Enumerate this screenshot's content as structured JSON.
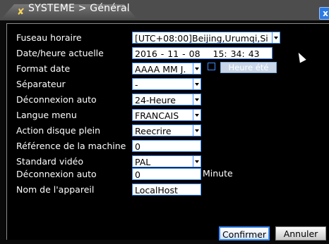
{
  "window": {
    "title": "SYSTEME > Général",
    "title_icon": "wrench-icon",
    "close_label": "x"
  },
  "form": {
    "timezone": {
      "label": "Fuseau horaire",
      "value": "[UTC+08:00]Beijing,Urumqi,Si"
    },
    "datetime": {
      "label": "Date/heure actuelle",
      "date": "2016 - 11 - 08",
      "time": "15: 34: 43"
    },
    "date_format": {
      "label": "Format date",
      "value": "AAAA MM J.",
      "dst_checked": false,
      "dst_button": "Heure été"
    },
    "separator": {
      "label": "Séparateur",
      "value": "-"
    },
    "time_format": {
      "label": "Déconnexion auto",
      "value": "24-Heure"
    },
    "language": {
      "label": "Langue menu",
      "value": "FRANCAIS"
    },
    "disk_full": {
      "label": "Action disque plein",
      "value": "Reecrire"
    },
    "machine_ref": {
      "label": "Référence de la machine",
      "value": "0"
    },
    "video_standard": {
      "label": "Standard vidéo",
      "value": "PAL"
    },
    "auto_logout": {
      "label": "Déconnexion auto",
      "value": "0",
      "unit": "Minute"
    },
    "device_name": {
      "label": "Nom de l'appareil",
      "value": "LocalHost"
    }
  },
  "footer": {
    "confirm_label": "Confirmer",
    "cancel_label": "Annuler"
  }
}
